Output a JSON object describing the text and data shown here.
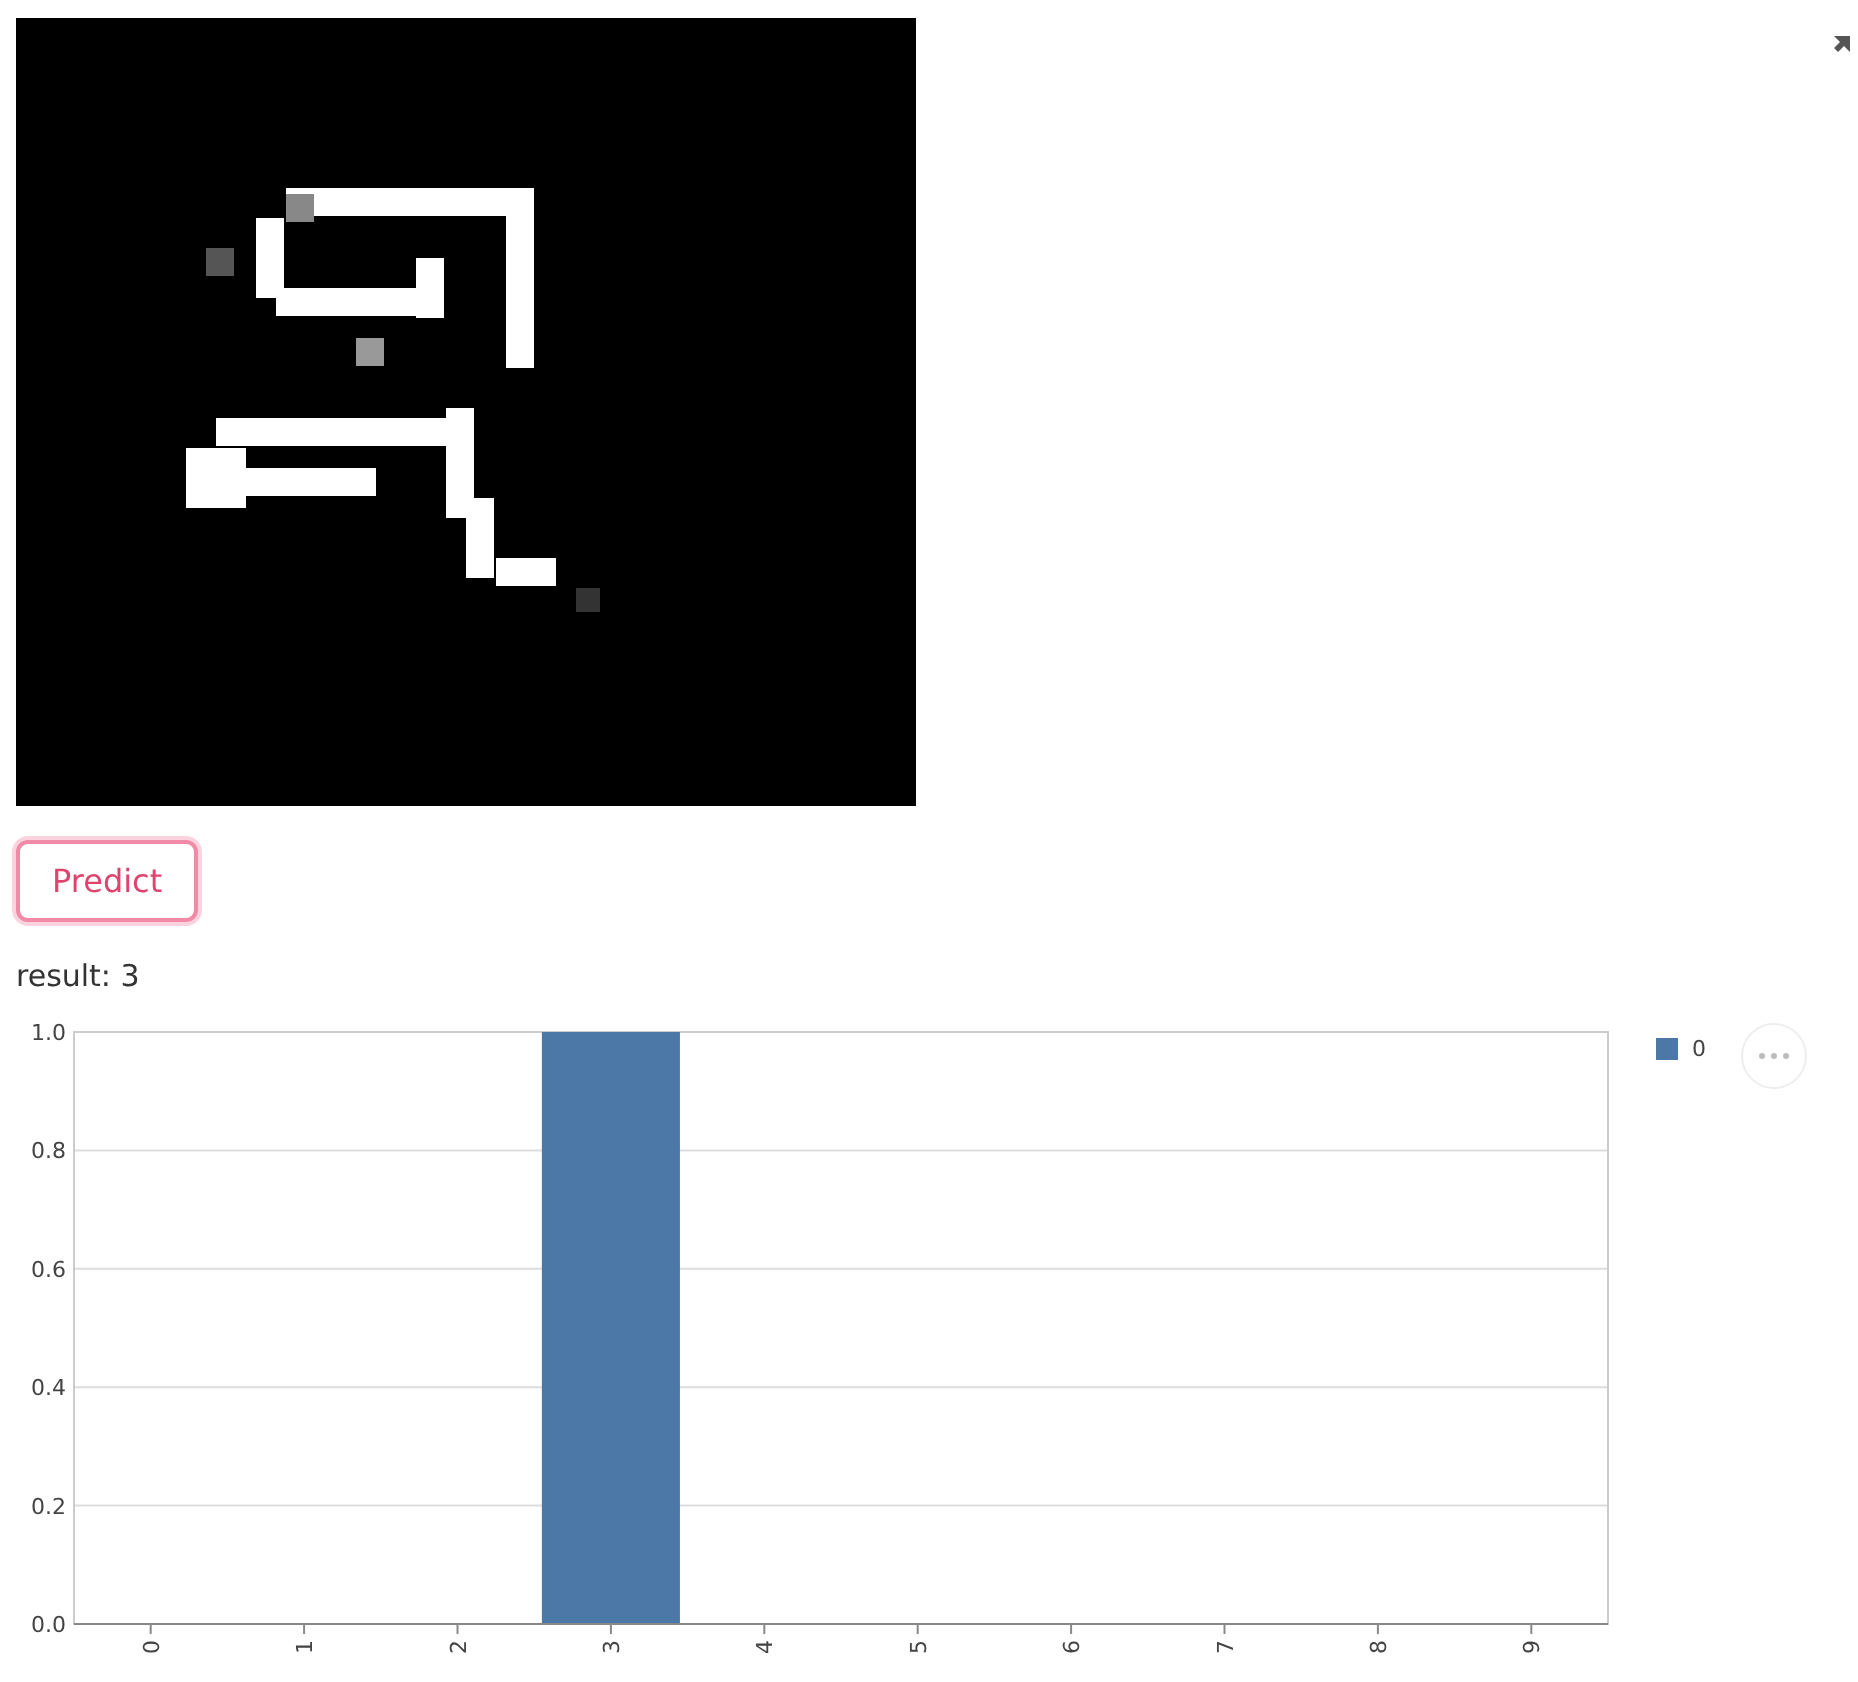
{
  "predict_button": {
    "label": "Predict"
  },
  "result": {
    "text": "result: 3"
  },
  "chart": {
    "chart_data": {
      "type": "bar",
      "categories": [
        "0",
        "1",
        "2",
        "3",
        "4",
        "5",
        "6",
        "7",
        "8",
        "9"
      ],
      "series": [
        {
          "name": "0",
          "color": "#4c78a8",
          "values": [
            0,
            0,
            0,
            1,
            0,
            0,
            0,
            0,
            0,
            0
          ]
        }
      ],
      "ylim": [
        0,
        1
      ],
      "grid": true,
      "yticks": [
        {
          "value": 0,
          "label": "0.0"
        },
        {
          "value": 0.2,
          "label": "0.2"
        },
        {
          "value": 0.4,
          "label": "0.4"
        },
        {
          "value": 0.6,
          "label": "0.6"
        },
        {
          "value": 0.8,
          "label": "0.8"
        },
        {
          "value": 1,
          "label": "1.0"
        }
      ]
    }
  }
}
